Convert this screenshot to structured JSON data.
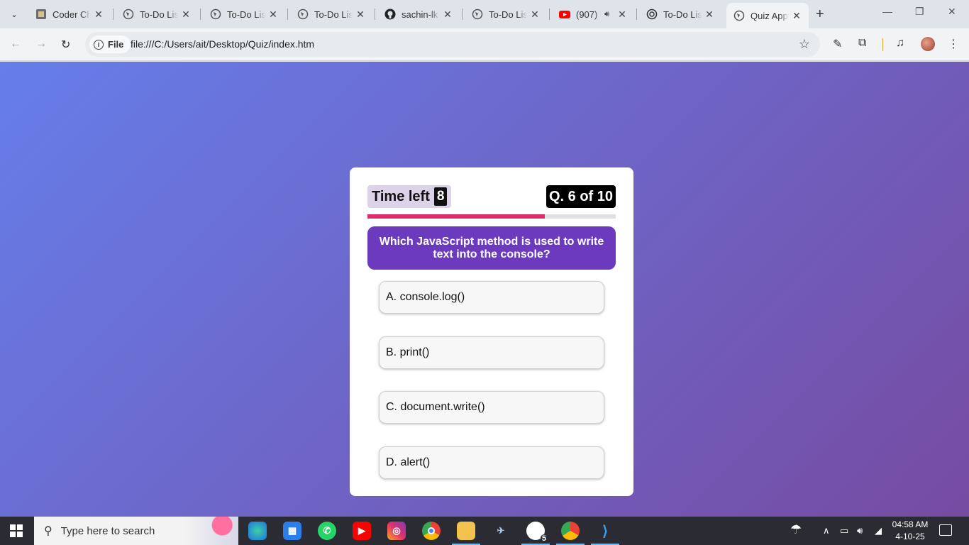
{
  "browser": {
    "tabs": [
      {
        "label": "Coder Ch",
        "icon": "coder-favicon-icon",
        "active": false
      },
      {
        "label": "To-Do List",
        "icon": "globe-icon",
        "active": false
      },
      {
        "label": "To-Do List",
        "icon": "globe-icon",
        "active": false
      },
      {
        "label": "To-Do List",
        "icon": "globe-icon",
        "active": false
      },
      {
        "label": "sachin-lk",
        "icon": "github-icon",
        "active": false
      },
      {
        "label": "To-Do List",
        "icon": "globe-icon",
        "active": false
      },
      {
        "label": "(907)",
        "icon": "youtube-icon",
        "active": false,
        "audio": true
      },
      {
        "label": "To-Do List",
        "icon": "chatgpt-icon",
        "active": false
      },
      {
        "label": "Quiz App",
        "icon": "globe-icon",
        "active": true
      }
    ],
    "chip_label": "File",
    "url": "file:///C:/Users/ait/Desktop/Quiz/index.htm"
  },
  "quiz": {
    "timer_label": "Time left",
    "timer_value": "8",
    "question_count": "Q. 6 of 10",
    "progress_fraction": 0.714,
    "question": "Which JavaScript method is used to write text into the console?",
    "options": [
      {
        "label": "A. console.log()"
      },
      {
        "label": "B. print()"
      },
      {
        "label": "C. document.write()"
      },
      {
        "label": "D. alert()"
      }
    ],
    "colors": {
      "question_bg": "#6c3bbd",
      "progress_fill": "#e02a6a",
      "page_gradient_start": "#667eea",
      "page_gradient_end": "#764ba2"
    }
  },
  "taskbar": {
    "search_placeholder": "Type here to search",
    "apps": [
      "edge-icon",
      "store-icon",
      "whatsapp-icon",
      "youtube-icon",
      "instagram-icon",
      "chrome-icon",
      "file-explorer-icon",
      "app-icon",
      "chatgpt-icon",
      "chrome-profile-icon",
      "vscode-icon"
    ],
    "whatsapp_badge": "5",
    "time": "04:58 AM",
    "date": "4-10-25"
  }
}
